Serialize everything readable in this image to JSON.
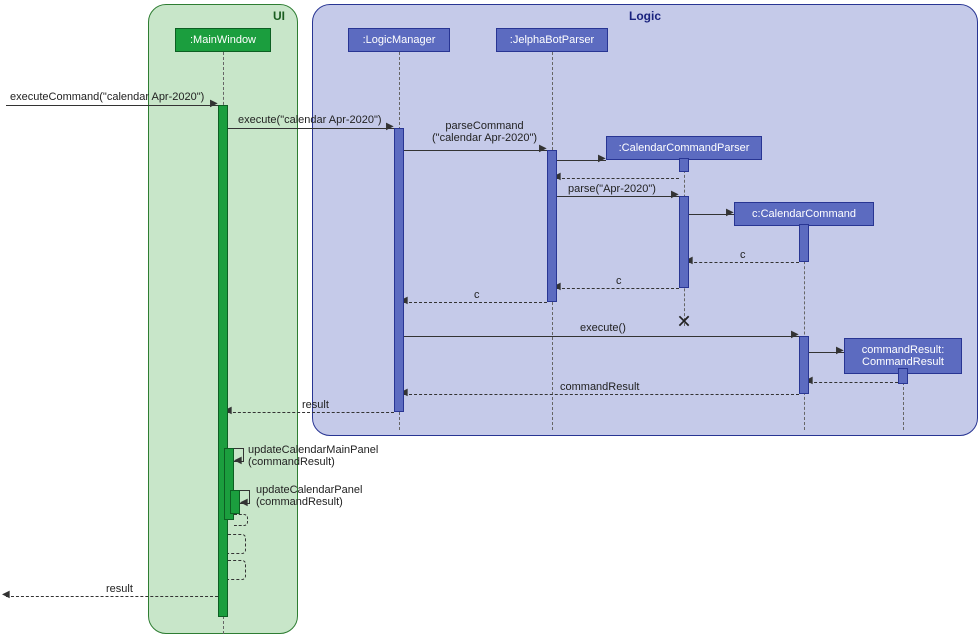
{
  "frames": {
    "ui": "UI",
    "logic": "Logic"
  },
  "participants": {
    "mainWindow": ":MainWindow",
    "logicManager": ":LogicManager",
    "jelphaBotParser": ":JelphaBotParser",
    "calendarCommandParser": ":CalendarCommandParser",
    "calendarCommand": "c:CalendarCommand",
    "commandResult": "commandResult:\nCommandResult"
  },
  "messages": {
    "executeCommand": "executeCommand(\"calendar Apr-2020\")",
    "execute": "execute(\"calendar Apr-2020\")",
    "parseCommand": "parseCommand\n(\"calendar Apr-2020\")",
    "parse": "parse(\"Apr-2020\")",
    "returnC1": "c",
    "returnC2": "c",
    "returnC3": "c",
    "executeCall": "execute()",
    "commandResultLabel": "commandResult",
    "result": "result",
    "updateMainPanel": "updateCalendarMainPanel\n(commandResult)",
    "updatePanel": "updateCalendarPanel\n(commandResult)",
    "resultOut": "result"
  }
}
